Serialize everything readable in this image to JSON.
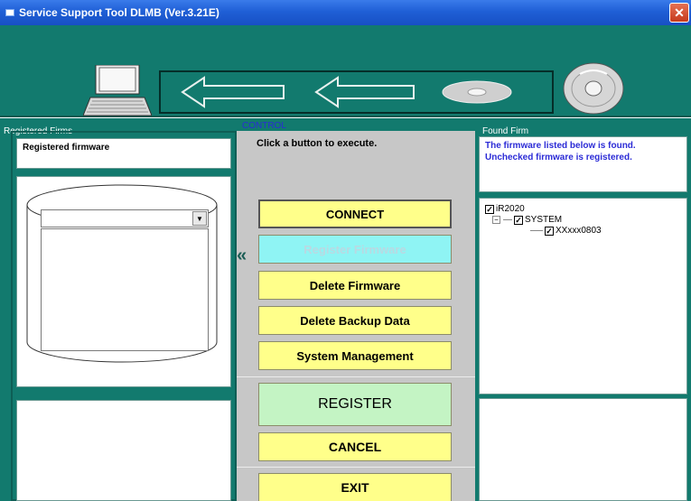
{
  "window": {
    "title": "Service Support Tool DLMB (Ver.3.21E)",
    "close_glyph": "✕"
  },
  "left": {
    "label": "Registered Firms",
    "header_text": "Registered firmware"
  },
  "control": {
    "label": "CONTROL",
    "hint": "Click a button to execute.",
    "chevron": "«",
    "buttons": {
      "connect": "CONNECT",
      "register_firmware": "Register Firmware",
      "delete_firmware": "Delete Firmware",
      "delete_backup": "Delete Backup Data",
      "system_management": "System Management",
      "register": "REGISTER",
      "cancel": "CANCEL",
      "exit": "EXIT"
    }
  },
  "right": {
    "label": "Found Firm",
    "info": "The firmware listed below is found. Unchecked firmware is registered.",
    "tree": {
      "root": "iR2020",
      "child": "SYSTEM",
      "leaf": "XXxxx0803",
      "expander": "−",
      "check": "✓"
    }
  },
  "colors": {
    "teal": "#127a6e",
    "button_yellow": "#ffff8a",
    "button_cyan": "#8ff4f4",
    "button_green": "#c4f4c4"
  },
  "icons": [
    "app-icon",
    "close-icon",
    "laptop-icon",
    "arrow-left-icon",
    "disc-icon",
    "chevron-double-left-icon",
    "dropdown-arrow-icon"
  ]
}
